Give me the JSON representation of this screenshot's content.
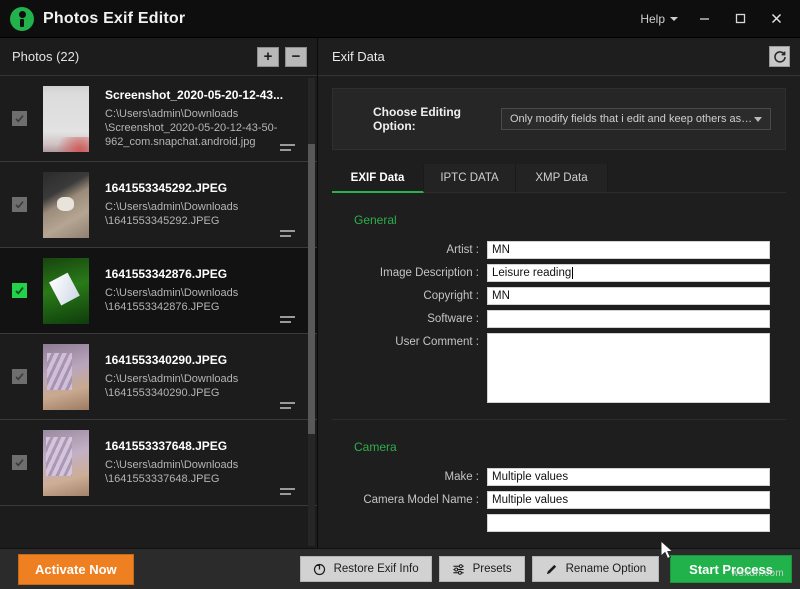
{
  "window": {
    "title": "Photos Exif Editor",
    "logo_icon": "person-pin-logo-icon",
    "help_label": "Help",
    "minimize_icon": "minimize-icon",
    "maximize_icon": "maximize-icon",
    "close_icon": "close-icon",
    "accent_green": "#22b24c",
    "accent_orange": "#ef8022"
  },
  "photos_panel": {
    "title": "Photos (22)",
    "add_label": "+",
    "remove_label": "−",
    "items": [
      {
        "name": "Screenshot_2020-05-20-12-43...",
        "path": "C:\\Users\\admin\\Downloads\n\\Screenshot_2020-05-20-12-43-50-\n962_com.snapchat.android.jpg",
        "checked": true,
        "selected": false
      },
      {
        "name": "1641553345292.JPEG",
        "path": "C:\\Users\\admin\\Downloads\n\\1641553345292.JPEG",
        "checked": true,
        "selected": false
      },
      {
        "name": "1641553342876.JPEG",
        "path": "C:\\Users\\admin\\Downloads\n\\1641553342876.JPEG",
        "checked": true,
        "selected": true
      },
      {
        "name": "1641553340290.JPEG",
        "path": "C:\\Users\\admin\\Downloads\n\\1641553340290.JPEG",
        "checked": true,
        "selected": false
      },
      {
        "name": "1641553337648.JPEG",
        "path": "C:\\Users\\admin\\Downloads\n\\1641553337648.JPEG",
        "checked": true,
        "selected": false
      }
    ]
  },
  "exif_panel": {
    "title": "Exif Data",
    "reset_icon": "refresh-icon",
    "editing_option_label": "Choose Editing Option:",
    "editing_option_value": "Only modify fields that i edit and keep others as it is",
    "tabs": [
      {
        "label": "EXIF Data",
        "active": true
      },
      {
        "label": "IPTC DATA",
        "active": false
      },
      {
        "label": "XMP Data",
        "active": false
      }
    ],
    "sections": [
      {
        "title": "General",
        "fields": [
          {
            "label": "Artist :",
            "value": "MN",
            "type": "text",
            "focused": false
          },
          {
            "label": "Image Description :",
            "value": "Leisure reading",
            "type": "text",
            "focused": true
          },
          {
            "label": "Copyright :",
            "value": "MN",
            "type": "text",
            "focused": false
          },
          {
            "label": "Software :",
            "value": "",
            "type": "text",
            "focused": false
          },
          {
            "label": "User Comment :",
            "value": "",
            "type": "textarea",
            "focused": false
          }
        ]
      },
      {
        "title": "Camera",
        "fields": [
          {
            "label": "Make :",
            "value": "Multiple values",
            "type": "text",
            "focused": false
          },
          {
            "label": "Camera Model Name :",
            "value": "Multiple values",
            "type": "text",
            "focused": false
          },
          {
            "label": "",
            "value": "",
            "type": "text",
            "focused": false
          }
        ]
      }
    ]
  },
  "bottom_bar": {
    "activate_label": "Activate Now",
    "restore_label": "Restore Exif Info",
    "restore_icon": "restore-icon",
    "presets_label": "Presets",
    "presets_icon": "sliders-icon",
    "rename_label": "Rename Option",
    "rename_icon": "pencil-icon",
    "start_label": "Start Process"
  },
  "watermark": "wsxdn.com"
}
